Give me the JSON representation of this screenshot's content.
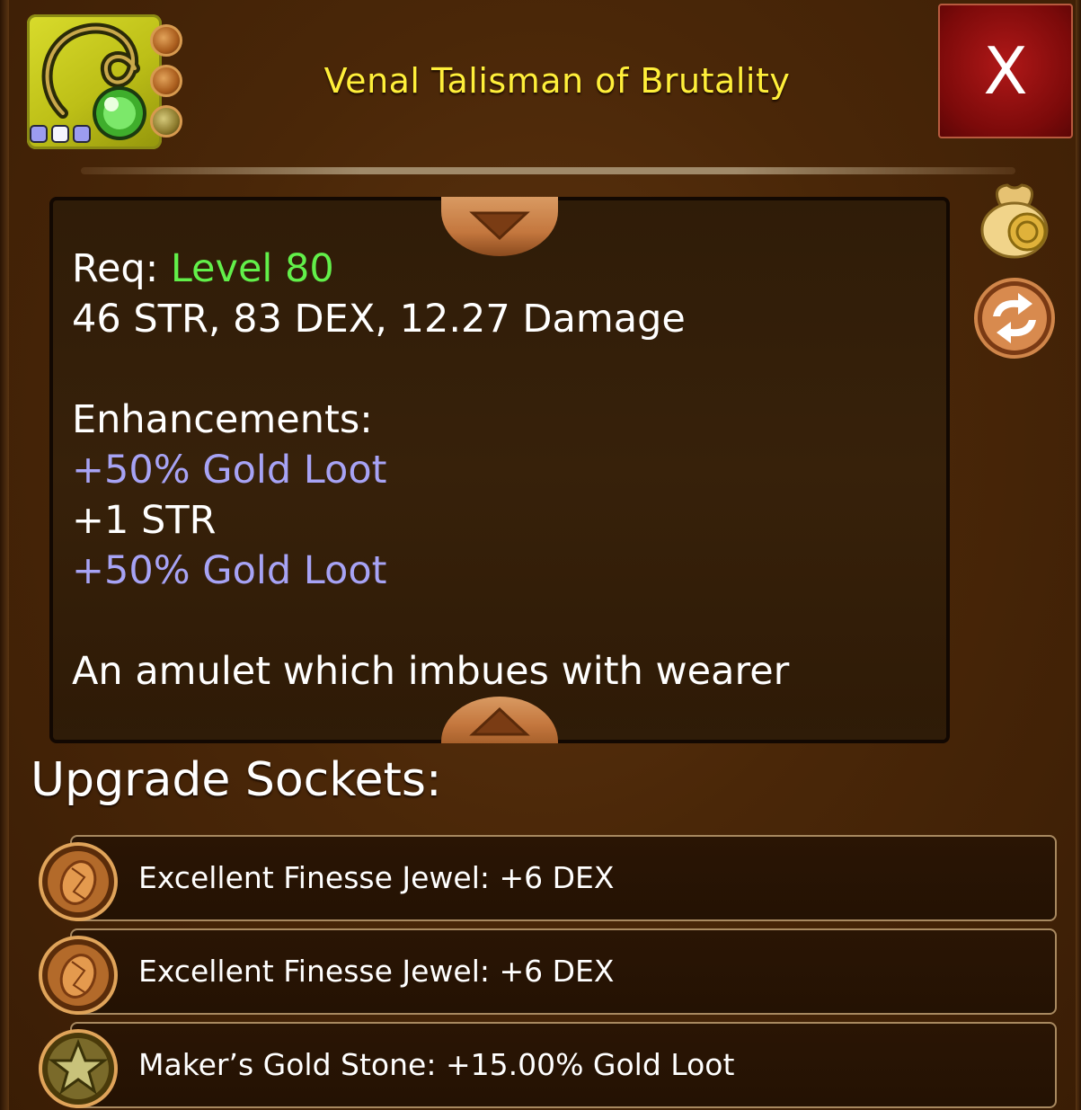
{
  "item": {
    "title": "Venal Talisman of Brutality",
    "icon": "amulet-icon",
    "rarity_dots": [
      "#9c9cf0",
      "#f4f4ff",
      "#9c9cf0"
    ],
    "mini_sockets": [
      "finesse-jewel-icon",
      "finesse-jewel-icon",
      "gold-stone-icon"
    ]
  },
  "close_button": {
    "label": "X"
  },
  "description": {
    "req_label": "Req:",
    "req_value": "Level 80",
    "stats": "46 STR, 83 DEX, 12.27 Damage",
    "enhancements_label": "Enhancements:",
    "enhancements": [
      {
        "text": "+50% Gold Loot",
        "color": "lilac"
      },
      {
        "text": "+1 STR",
        "color": "white"
      },
      {
        "text": "+50% Gold Loot",
        "color": "lilac"
      }
    ],
    "flavor": "An amulet which imbues with wearer"
  },
  "side_buttons": [
    "sell-gold-bag-icon",
    "swap-arrows-icon"
  ],
  "sockets": {
    "header": "Upgrade Sockets:",
    "items": [
      {
        "icon": "finesse-jewel-icon",
        "label": "Excellent Finesse Jewel: +6 DEX"
      },
      {
        "icon": "finesse-jewel-icon",
        "label": "Excellent Finesse Jewel: +6 DEX"
      },
      {
        "icon": "gold-stone-icon",
        "label": "Maker’s Gold Stone: +15.00% Gold Loot"
      }
    ]
  },
  "colors": {
    "title": "#ffef3a",
    "req_value": "#62f04a",
    "enhancement_gold": "#a7a3f5",
    "close_bg": "#9a1010"
  }
}
